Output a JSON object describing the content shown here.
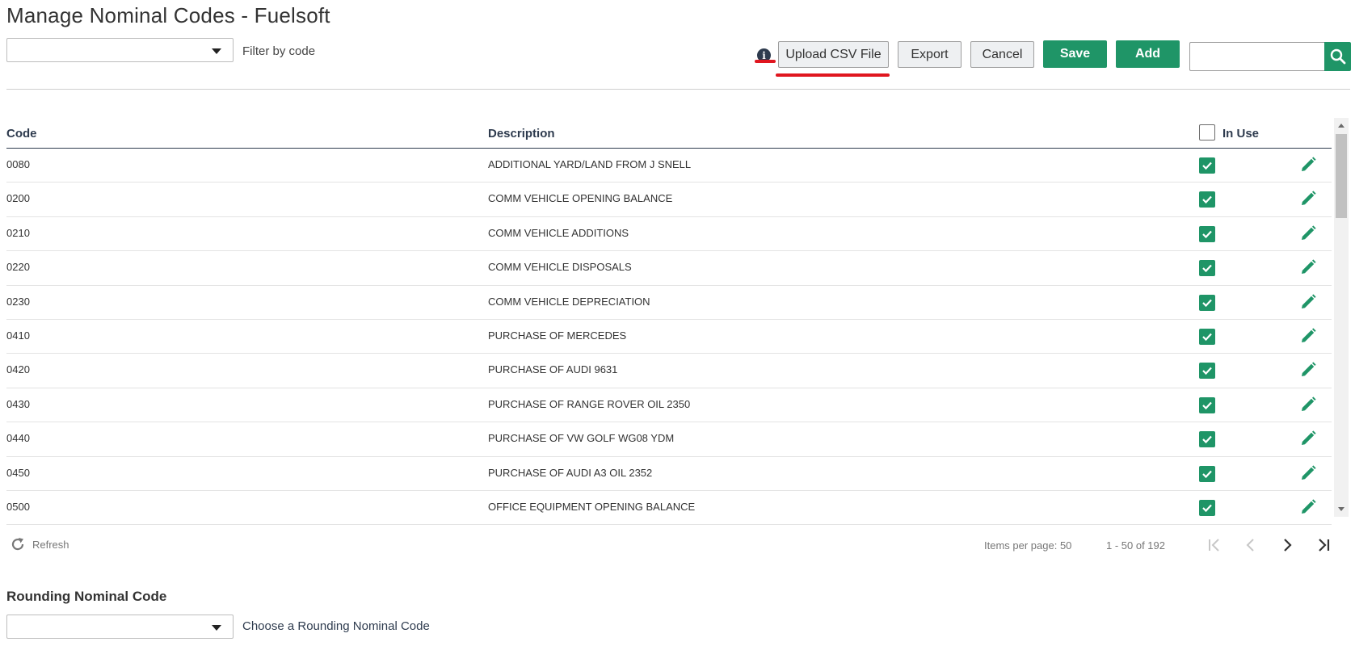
{
  "page": {
    "title": "Manage Nominal Codes - Fuelsoft"
  },
  "filter": {
    "selected": "",
    "label": "Filter by code"
  },
  "toolbar": {
    "upload_label": "Upload CSV File",
    "export_label": "Export",
    "cancel_label": "Cancel",
    "save_label": "Save",
    "add_label": "Add",
    "search_value": "",
    "info_glyph": "i"
  },
  "colors": {
    "accent": "#1f9567",
    "header_text": "#2e3b4e",
    "highlight": "#e0161f"
  },
  "grid": {
    "headers": {
      "code": "Code",
      "description": "Description",
      "in_use": "In Use"
    },
    "rows": [
      {
        "code": "0080",
        "description": "ADDITIONAL YARD/LAND FROM J SNELL",
        "in_use": true
      },
      {
        "code": "0200",
        "description": "COMM VEHICLE OPENING BALANCE",
        "in_use": true
      },
      {
        "code": "0210",
        "description": "COMM VEHICLE ADDITIONS",
        "in_use": true
      },
      {
        "code": "0220",
        "description": "COMM VEHICLE DISPOSALS",
        "in_use": true
      },
      {
        "code": "0230",
        "description": "COMM VEHICLE DEPRECIATION",
        "in_use": true
      },
      {
        "code": "0410",
        "description": "PURCHASE OF MERCEDES",
        "in_use": true
      },
      {
        "code": "0420",
        "description": "PURCHASE OF AUDI 9631",
        "in_use": true
      },
      {
        "code": "0430",
        "description": "PURCHASE OF RANGE ROVER OIL 2350",
        "in_use": true
      },
      {
        "code": "0440",
        "description": "PURCHASE OF VW GOLF WG08 YDM",
        "in_use": true
      },
      {
        "code": "0450",
        "description": "PURCHASE OF AUDI A3 OIL 2352",
        "in_use": true
      },
      {
        "code": "0500",
        "description": "OFFICE EQUIPMENT OPENING BALANCE",
        "in_use": true
      }
    ]
  },
  "footer": {
    "refresh_label": "Refresh",
    "items_per_page_label": "Items per page: 50",
    "range_label": "1 - 50 of 192"
  },
  "rounding": {
    "title": "Rounding Nominal Code",
    "selected": "",
    "label": "Choose a Rounding Nominal Code"
  }
}
